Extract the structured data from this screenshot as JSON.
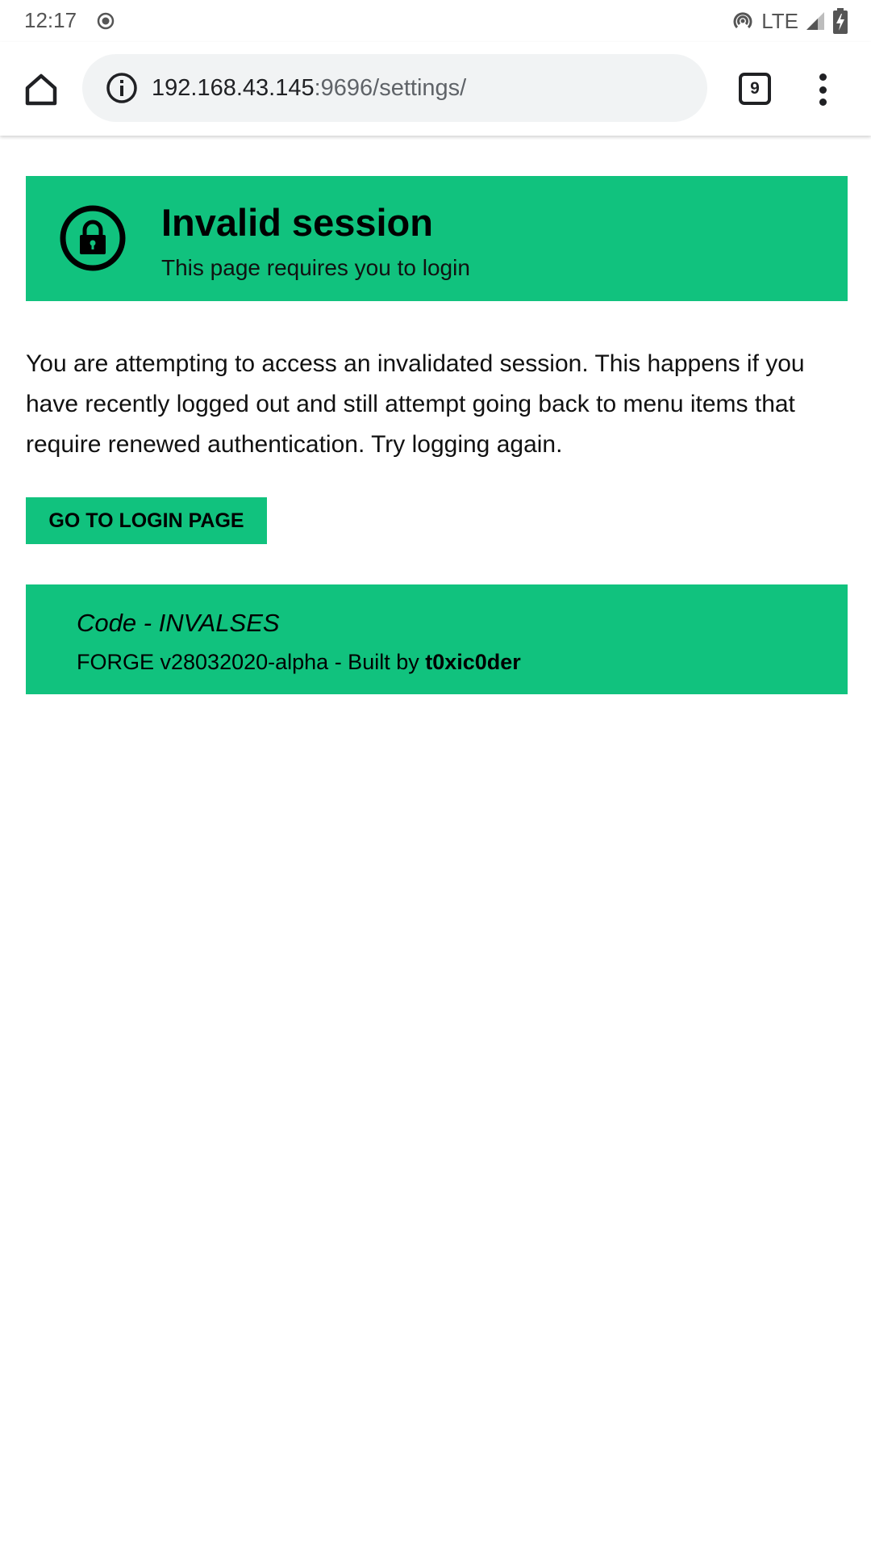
{
  "status_bar": {
    "time": "12:17",
    "network": "LTE",
    "icons": [
      "record-icon",
      "hotspot-icon",
      "signal-icon",
      "battery-charging-icon"
    ]
  },
  "browser": {
    "url_host": "192.168.43.145",
    "url_path": ":9696/settings/",
    "tab_count": "9",
    "icons": [
      "home-icon",
      "info-icon",
      "more-vert-icon"
    ]
  },
  "alert": {
    "title": "Invalid session",
    "subtitle": "This page requires you to login",
    "icon": "lock-icon"
  },
  "message": "You are attempting to access an invalidated session. This happens if you have recently logged out and still attempt going back to menu items that require renewed authentication. Try logging again.",
  "login_button": {
    "label": "GO TO LOGIN PAGE"
  },
  "footer": {
    "code": "Code - INVALSES",
    "build_prefix": "FORGE v28032020-alpha - Built by ",
    "author": "t0xic0der"
  },
  "colors": {
    "accent": "#11c27e",
    "url_bar_bg": "#f1f3f4",
    "text": "#000000"
  }
}
